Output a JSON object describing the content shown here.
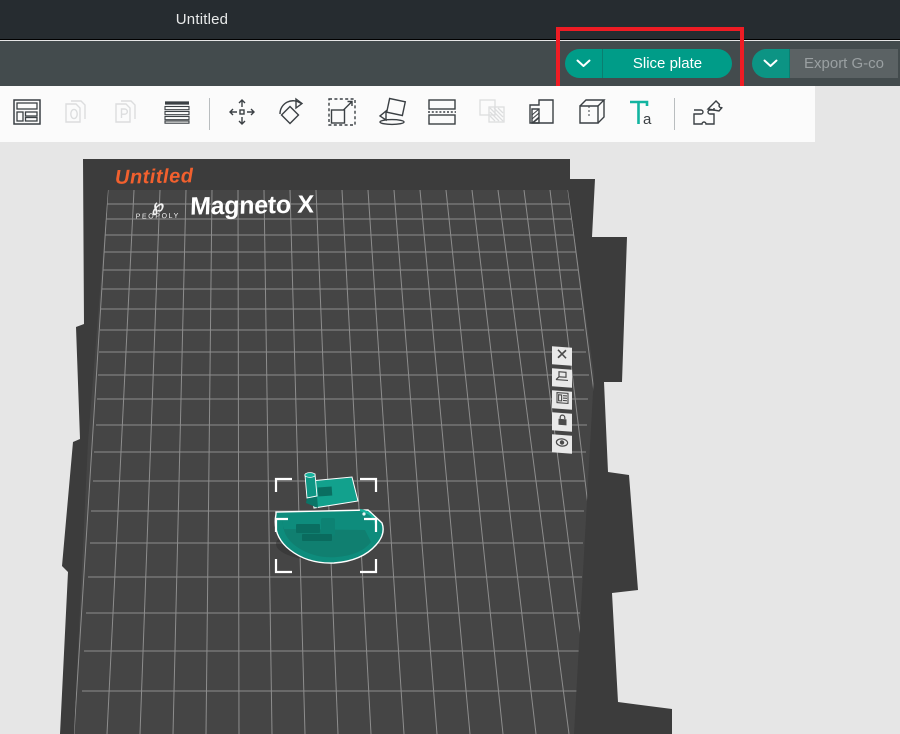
{
  "window": {
    "title": "Untitled"
  },
  "actions": {
    "slice": {
      "label": "Slice plate",
      "caret_icon": "chevron-down-icon",
      "color": "#009c88"
    },
    "export": {
      "label": "Export G-co",
      "caret_icon": "chevron-down-icon",
      "enabled": false,
      "color": "#5b6264"
    },
    "highlight_color": "#ee1c24"
  },
  "toolbar": {
    "items": [
      {
        "name": "layout-panel-icon",
        "tooltip": "Toggle panel",
        "enabled": true
      },
      {
        "name": "add-object-icon",
        "tooltip": "Add object",
        "enabled": false
      },
      {
        "name": "add-plate-icon",
        "tooltip": "Add plate",
        "enabled": false
      },
      {
        "name": "layers-icon",
        "tooltip": "Layers",
        "enabled": true
      },
      {
        "name": "move-icon",
        "tooltip": "Move",
        "enabled": true
      },
      {
        "name": "rotate-icon",
        "tooltip": "Rotate",
        "enabled": true
      },
      {
        "name": "scale-icon",
        "tooltip": "Scale",
        "enabled": true
      },
      {
        "name": "lay-flat-icon",
        "tooltip": "Place on face",
        "enabled": true
      },
      {
        "name": "cut-icon",
        "tooltip": "Cut",
        "enabled": true
      },
      {
        "name": "support-paint-icon",
        "tooltip": "Support painting",
        "enabled": false
      },
      {
        "name": "seam-paint-icon",
        "tooltip": "Seam painting",
        "enabled": true
      },
      {
        "name": "mesh-boolean-icon",
        "tooltip": "Mesh boolean",
        "enabled": true
      },
      {
        "name": "text-tool-icon",
        "tooltip": "Text shape",
        "enabled": true,
        "accent": true
      },
      {
        "name": "assembly-icon",
        "tooltip": "Assembly view",
        "enabled": true
      }
    ]
  },
  "viewport": {
    "plate_label": "Untitled",
    "plate_label_color": "#f2602e",
    "printer_brand_glyph": "℘",
    "printer_brand": "PEOPOLY",
    "printer_model": "Magneto X",
    "plate_color": "#454545",
    "grid_color": "#9a9a9a",
    "background_color": "#e6e6e6",
    "model": {
      "name": "3DBenchy",
      "color": "#0e8c7c",
      "selected": true
    },
    "plate_tools": [
      {
        "name": "close-icon",
        "tooltip": "Delete plate"
      },
      {
        "name": "arrange-icon",
        "tooltip": "Arrange objects"
      },
      {
        "name": "plate-settings-icon",
        "tooltip": "Plate settings"
      },
      {
        "name": "lock-icon",
        "tooltip": "Lock plate"
      },
      {
        "name": "eye-icon",
        "tooltip": "Show/hide"
      }
    ]
  }
}
